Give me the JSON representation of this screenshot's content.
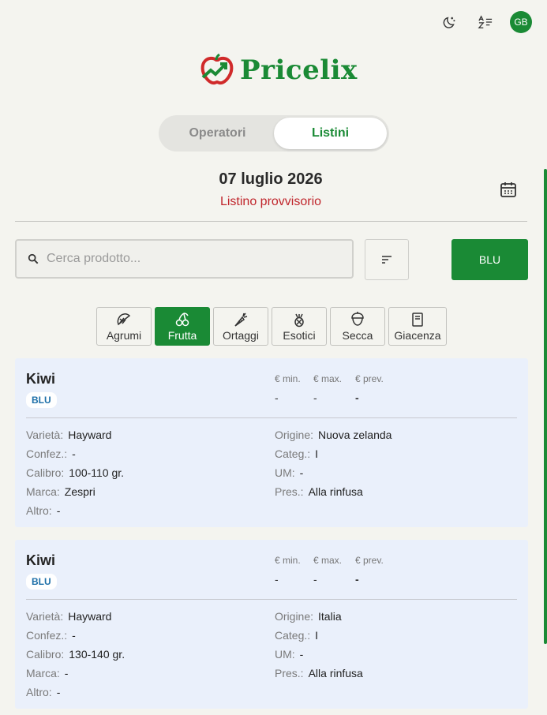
{
  "header": {
    "brand": "Pricelix",
    "avatar_initials": "GB",
    "icons": [
      "theme-toggle-icon",
      "translate-icon"
    ]
  },
  "tabs": [
    {
      "label": "Operatori",
      "active": false
    },
    {
      "label": "Listini",
      "active": true
    }
  ],
  "listino": {
    "date": "07 luglio 2026",
    "status": "Listino provvisorio"
  },
  "search": {
    "placeholder": "Cerca prodotto...",
    "value": ""
  },
  "filter_button": "BLU",
  "categories": [
    {
      "label": "Agrumi",
      "icon": "citrus-icon",
      "active": false
    },
    {
      "label": "Frutta",
      "icon": "cherry-icon",
      "active": true
    },
    {
      "label": "Ortaggi",
      "icon": "carrot-icon",
      "active": false
    },
    {
      "label": "Esotici",
      "icon": "pineapple-icon",
      "active": false
    },
    {
      "label": "Secca",
      "icon": "nut-icon",
      "active": false
    },
    {
      "label": "Giacenza",
      "icon": "inventory-icon",
      "active": false
    }
  ],
  "price_headers": {
    "min": "€ min.",
    "max": "€ max.",
    "prev": "€ prev."
  },
  "field_labels": {
    "varieta": "Varietà:",
    "confez": "Confez.:",
    "calibro": "Calibro:",
    "marca": "Marca:",
    "altro": "Altro:",
    "origine": "Origine:",
    "categ": "Categ.:",
    "um": "UM:",
    "pres": "Pres.:"
  },
  "products": [
    {
      "name": "Kiwi",
      "badge": "BLU",
      "price_min": "-",
      "price_max": "-",
      "price_prev": "-",
      "varieta": "Hayward",
      "confez": "-",
      "calibro": "100-110 gr.",
      "marca": "Zespri",
      "altro": "-",
      "origine": "Nuova zelanda",
      "categ": "I",
      "um": "-",
      "pres": "Alla rinfusa"
    },
    {
      "name": "Kiwi",
      "badge": "BLU",
      "price_min": "-",
      "price_max": "-",
      "price_prev": "-",
      "varieta": "Hayward",
      "confez": "-",
      "calibro": "130-140 gr.",
      "marca": "-",
      "altro": "-",
      "origine": "Italia",
      "categ": "I",
      "um": "-",
      "pres": "Alla rinfusa"
    }
  ],
  "colors": {
    "brand_green": "#1a8a35",
    "status_red": "#c0262c",
    "card_bg": "#eaf0fb",
    "badge_blue": "#1d6fa8"
  }
}
